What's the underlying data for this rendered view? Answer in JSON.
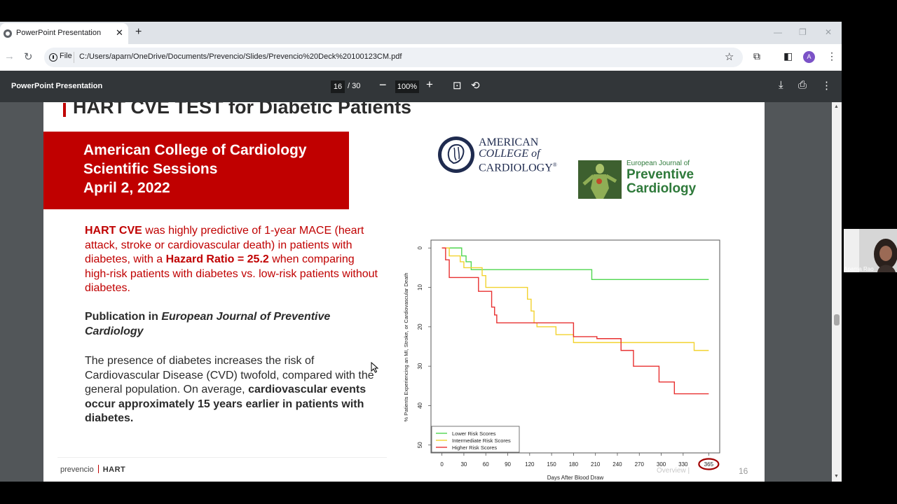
{
  "browser": {
    "tab_title": "PowerPoint Presentation",
    "tab_close": "✕",
    "new_tab": "+",
    "window_controls": [
      "—",
      "❐",
      "✕"
    ],
    "file_chip": "File",
    "url": "C:/Users/aparn/OneDrive/Documents/Prevencio/Slides/Prevencio%20Deck%20100123CM.pdf",
    "avatar_letter": "A"
  },
  "pdf_toolbar": {
    "title": "PowerPoint Presentation",
    "page_current": "16",
    "page_total": "/ 30",
    "zoom_minus": "−",
    "zoom": "100%",
    "zoom_plus": "+"
  },
  "slide": {
    "title": "HART CVE TEST for Diabetic Patients",
    "banner": [
      "American College of Cardiology",
      "Scientific Sessions",
      "April 2, 2022"
    ],
    "p1": {
      "strong1": "HART CVE",
      "text1": " was highly predictive of 1-year MACE (heart attack, stroke or cardiovascular death) in patients with diabetes, with a ",
      "strong2": "Hazard Ratio = 25.2",
      "text2": " when comparing high-risk patients with diabetes vs. low-risk patients without diabetes."
    },
    "p2": {
      "text1": "Publication in ",
      "italic": "European Journal of Preventive Cardiology"
    },
    "p3": {
      "text1": "The presence of diabetes increases the risk of Cardiovascular Disease (CVD) twofold, compared with the general population. On average, ",
      "strong": "cardiovascular events occur approximately 15 years earlier in patients with diabetes."
    },
    "acc_logo_lines": [
      "AMERICAN",
      "COLLEGE of",
      "CARDIOLOGY"
    ],
    "acc_registered": "®",
    "ejpc_small": "European Journal of",
    "ejpc_big_lines": [
      "Preventive",
      "Cardiology"
    ],
    "footer_brand": "prevencio",
    "footer_hart": "HART",
    "footer_nav": "Overview |",
    "page_number": "16"
  },
  "chart_data": {
    "type": "line",
    "title": "",
    "xlabel": "Days After Blood Draw",
    "ylabel": "% Patients Experiencing an MI, Stroke, or Cardiovascular Death",
    "x_ticks": [
      "0",
      "30",
      "60",
      "90",
      "120",
      "150",
      "180",
      "210",
      "240",
      "270",
      "300",
      "330",
      "365"
    ],
    "y_ticks": [
      "0",
      "10",
      "20",
      "30",
      "40",
      "50"
    ],
    "xlim": [
      -15,
      380
    ],
    "ylim": [
      -2,
      52
    ],
    "y_inverted": true,
    "highlighted_tick": "365",
    "legend_position": "bottom-left",
    "series": [
      {
        "name": "Lower Risk Scores",
        "color": "#4fd64f",
        "step": true,
        "x": [
          0,
          27,
          33,
          40,
          205,
          365
        ],
        "y": [
          0,
          2,
          3.5,
          5.5,
          8,
          8
        ]
      },
      {
        "name": "Intermediate Risk Scores",
        "color": "#f2d22e",
        "step": true,
        "x": [
          0,
          10,
          25,
          30,
          55,
          60,
          117,
          122,
          126,
          130,
          156,
          180,
          240,
          345,
          365
        ],
        "y": [
          0,
          2,
          3.5,
          5,
          7,
          10,
          13,
          16,
          19,
          20,
          22,
          24,
          24,
          26,
          26
        ]
      },
      {
        "name": "Higher Risk Scores",
        "color": "#e83030",
        "step": true,
        "x": [
          0,
          5,
          10,
          50,
          68,
          72,
          75,
          180,
          212,
          245,
          262,
          297,
          318,
          365
        ],
        "y": [
          0,
          3,
          7.5,
          11,
          15,
          17,
          19,
          22.5,
          23,
          26,
          30,
          34,
          37,
          37
        ]
      }
    ]
  },
  "video": {
    "name": "Aparna Rao"
  }
}
